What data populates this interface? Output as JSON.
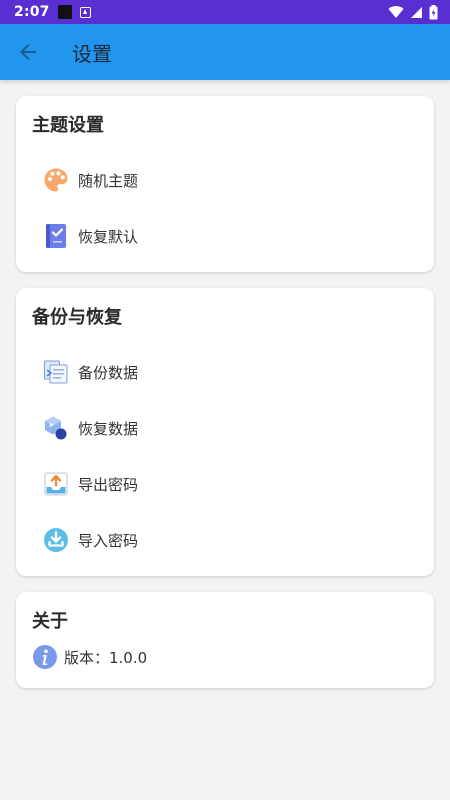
{
  "status_bar": {
    "time": "2:07",
    "background": "#5a2fd1"
  },
  "app_bar": {
    "title": "设置",
    "back_icon": "arrow-back-icon",
    "background": "#2295ef"
  },
  "sections": {
    "theme": {
      "title": "主题设置",
      "items": [
        {
          "label": "随机主题",
          "icon": "palette-icon"
        },
        {
          "label": "恢复默认",
          "icon": "book-check-icon"
        }
      ]
    },
    "backup": {
      "title": "备份与恢复",
      "items": [
        {
          "label": "备份数据",
          "icon": "backup-files-icon"
        },
        {
          "label": "恢复数据",
          "icon": "restore-cube-icon"
        },
        {
          "label": "导出密码",
          "icon": "export-upload-icon"
        },
        {
          "label": "导入密码",
          "icon": "import-download-icon"
        }
      ]
    },
    "about": {
      "title": "关于",
      "version_text": "版本：1.0.0",
      "icon": "info-icon"
    }
  }
}
